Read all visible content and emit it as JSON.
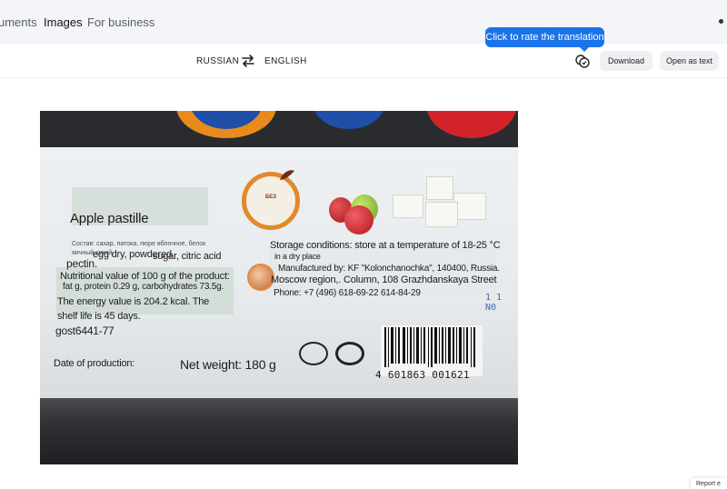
{
  "nav": {
    "tabs": [
      {
        "label": "uments",
        "active": false
      },
      {
        "label": "Images",
        "active": true
      },
      {
        "label": "For business",
        "active": false
      }
    ]
  },
  "toolbar": {
    "source_lang": "RUSSIAN",
    "target_lang": "ENGLISH",
    "swap_icon": "swap-arrows-icon",
    "rate_icon": "rate-translation-icon",
    "download_label": "Download",
    "open_as_text_label": "Open as text"
  },
  "tooltip": {
    "text": "Click to rate the translation"
  },
  "image": {
    "overlays": {
      "product_name": "Apple pastille",
      "ingredients_ru": "Состав: сахар, патока, пюре яблочное, белок яичный сухой,",
      "ingredients_1": "egg dry, powdered",
      "ingredients_2": "sugar, citric acid",
      "ingredients_3": "pectin.",
      "nutrition_1": "Nutritional value of 100 g of the product:",
      "nutrition_2": "fat g, protein 0.29 g, carbohydrates 73.5g.",
      "energy": "The energy value is 204.2 kcal. The",
      "shelf_life": "shelf life is 45 days.",
      "gost": "gost6441-77",
      "date": "Date of production:",
      "net_weight": "Net weight: 180 g",
      "storage_1": "Storage conditions: store at a temperature of 18-25 °C",
      "storage_2": "in a dry place",
      "manufacturer_1": "Manufactured by: KF \"Kolonchanochka\", 140400, Russia.",
      "manufacturer_2": "Moscow region,. Column, 108 Grazhdanskaya Street",
      "phone": "Phone: +7 (496) 618-69-22 614-84-29",
      "barcode_number": "4 601863 001621",
      "side_number": "1 1 N0"
    },
    "seal_text": "БЕЗ",
    "colors": {
      "cup_blue": "#1f4fa8",
      "cup_red": "#d2232a",
      "cup_orange": "#e98b1c",
      "seal_orange": "#e2892a"
    }
  },
  "report": {
    "label": "Report e"
  },
  "colors": {
    "accent": "#1a73e8",
    "nav_bg": "#f4f5f8",
    "button_bg": "#eef0f4"
  }
}
